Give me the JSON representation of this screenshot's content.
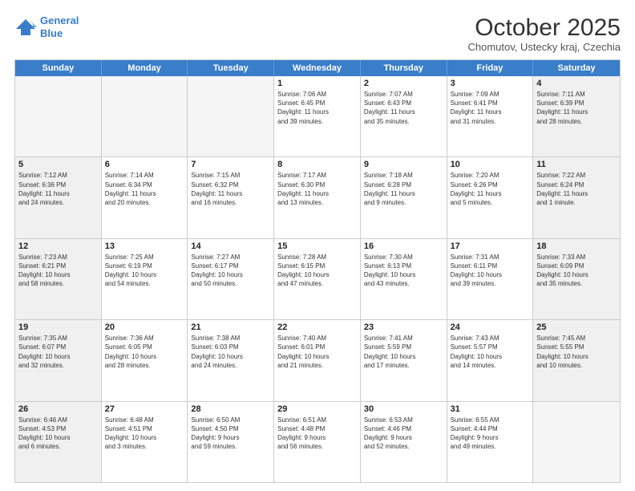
{
  "header": {
    "logo_line1": "General",
    "logo_line2": "Blue",
    "month_title": "October 2025",
    "subtitle": "Chomutov, Ustecky kraj, Czechia"
  },
  "weekdays": [
    "Sunday",
    "Monday",
    "Tuesday",
    "Wednesday",
    "Thursday",
    "Friday",
    "Saturday"
  ],
  "rows": [
    [
      {
        "day": "",
        "text": "",
        "empty": true
      },
      {
        "day": "",
        "text": "",
        "empty": true
      },
      {
        "day": "",
        "text": "",
        "empty": true
      },
      {
        "day": "1",
        "text": "Sunrise: 7:06 AM\nSunset: 6:45 PM\nDaylight: 11 hours\nand 39 minutes."
      },
      {
        "day": "2",
        "text": "Sunrise: 7:07 AM\nSunset: 6:43 PM\nDaylight: 11 hours\nand 35 minutes."
      },
      {
        "day": "3",
        "text": "Sunrise: 7:09 AM\nSunset: 6:41 PM\nDaylight: 11 hours\nand 31 minutes."
      },
      {
        "day": "4",
        "text": "Sunrise: 7:11 AM\nSunset: 6:39 PM\nDaylight: 11 hours\nand 28 minutes.",
        "shaded": true
      }
    ],
    [
      {
        "day": "5",
        "text": "Sunrise: 7:12 AM\nSunset: 6:36 PM\nDaylight: 11 hours\nand 24 minutes.",
        "shaded": true
      },
      {
        "day": "6",
        "text": "Sunrise: 7:14 AM\nSunset: 6:34 PM\nDaylight: 11 hours\nand 20 minutes."
      },
      {
        "day": "7",
        "text": "Sunrise: 7:15 AM\nSunset: 6:32 PM\nDaylight: 11 hours\nand 16 minutes."
      },
      {
        "day": "8",
        "text": "Sunrise: 7:17 AM\nSunset: 6:30 PM\nDaylight: 11 hours\nand 13 minutes."
      },
      {
        "day": "9",
        "text": "Sunrise: 7:18 AM\nSunset: 6:28 PM\nDaylight: 11 hours\nand 9 minutes."
      },
      {
        "day": "10",
        "text": "Sunrise: 7:20 AM\nSunset: 6:26 PM\nDaylight: 11 hours\nand 5 minutes."
      },
      {
        "day": "11",
        "text": "Sunrise: 7:22 AM\nSunset: 6:24 PM\nDaylight: 11 hours\nand 1 minute.",
        "shaded": true
      }
    ],
    [
      {
        "day": "12",
        "text": "Sunrise: 7:23 AM\nSunset: 6:21 PM\nDaylight: 10 hours\nand 58 minutes.",
        "shaded": true
      },
      {
        "day": "13",
        "text": "Sunrise: 7:25 AM\nSunset: 6:19 PM\nDaylight: 10 hours\nand 54 minutes."
      },
      {
        "day": "14",
        "text": "Sunrise: 7:27 AM\nSunset: 6:17 PM\nDaylight: 10 hours\nand 50 minutes."
      },
      {
        "day": "15",
        "text": "Sunrise: 7:28 AM\nSunset: 6:15 PM\nDaylight: 10 hours\nand 47 minutes."
      },
      {
        "day": "16",
        "text": "Sunrise: 7:30 AM\nSunset: 6:13 PM\nDaylight: 10 hours\nand 43 minutes."
      },
      {
        "day": "17",
        "text": "Sunrise: 7:31 AM\nSunset: 6:11 PM\nDaylight: 10 hours\nand 39 minutes."
      },
      {
        "day": "18",
        "text": "Sunrise: 7:33 AM\nSunset: 6:09 PM\nDaylight: 10 hours\nand 35 minutes.",
        "shaded": true
      }
    ],
    [
      {
        "day": "19",
        "text": "Sunrise: 7:35 AM\nSunset: 6:07 PM\nDaylight: 10 hours\nand 32 minutes.",
        "shaded": true
      },
      {
        "day": "20",
        "text": "Sunrise: 7:36 AM\nSunset: 6:05 PM\nDaylight: 10 hours\nand 28 minutes."
      },
      {
        "day": "21",
        "text": "Sunrise: 7:38 AM\nSunset: 6:03 PM\nDaylight: 10 hours\nand 24 minutes."
      },
      {
        "day": "22",
        "text": "Sunrise: 7:40 AM\nSunset: 6:01 PM\nDaylight: 10 hours\nand 21 minutes."
      },
      {
        "day": "23",
        "text": "Sunrise: 7:41 AM\nSunset: 5:59 PM\nDaylight: 10 hours\nand 17 minutes."
      },
      {
        "day": "24",
        "text": "Sunrise: 7:43 AM\nSunset: 5:57 PM\nDaylight: 10 hours\nand 14 minutes."
      },
      {
        "day": "25",
        "text": "Sunrise: 7:45 AM\nSunset: 5:55 PM\nDaylight: 10 hours\nand 10 minutes.",
        "shaded": true
      }
    ],
    [
      {
        "day": "26",
        "text": "Sunrise: 6:46 AM\nSunset: 4:53 PM\nDaylight: 10 hours\nand 6 minutes.",
        "shaded": true
      },
      {
        "day": "27",
        "text": "Sunrise: 6:48 AM\nSunset: 4:51 PM\nDaylight: 10 hours\nand 3 minutes."
      },
      {
        "day": "28",
        "text": "Sunrise: 6:50 AM\nSunset: 4:50 PM\nDaylight: 9 hours\nand 59 minutes."
      },
      {
        "day": "29",
        "text": "Sunrise: 6:51 AM\nSunset: 4:48 PM\nDaylight: 9 hours\nand 56 minutes."
      },
      {
        "day": "30",
        "text": "Sunrise: 6:53 AM\nSunset: 4:46 PM\nDaylight: 9 hours\nand 52 minutes."
      },
      {
        "day": "31",
        "text": "Sunrise: 6:55 AM\nSunset: 4:44 PM\nDaylight: 9 hours\nand 49 minutes."
      },
      {
        "day": "",
        "text": "",
        "empty": true
      }
    ]
  ]
}
